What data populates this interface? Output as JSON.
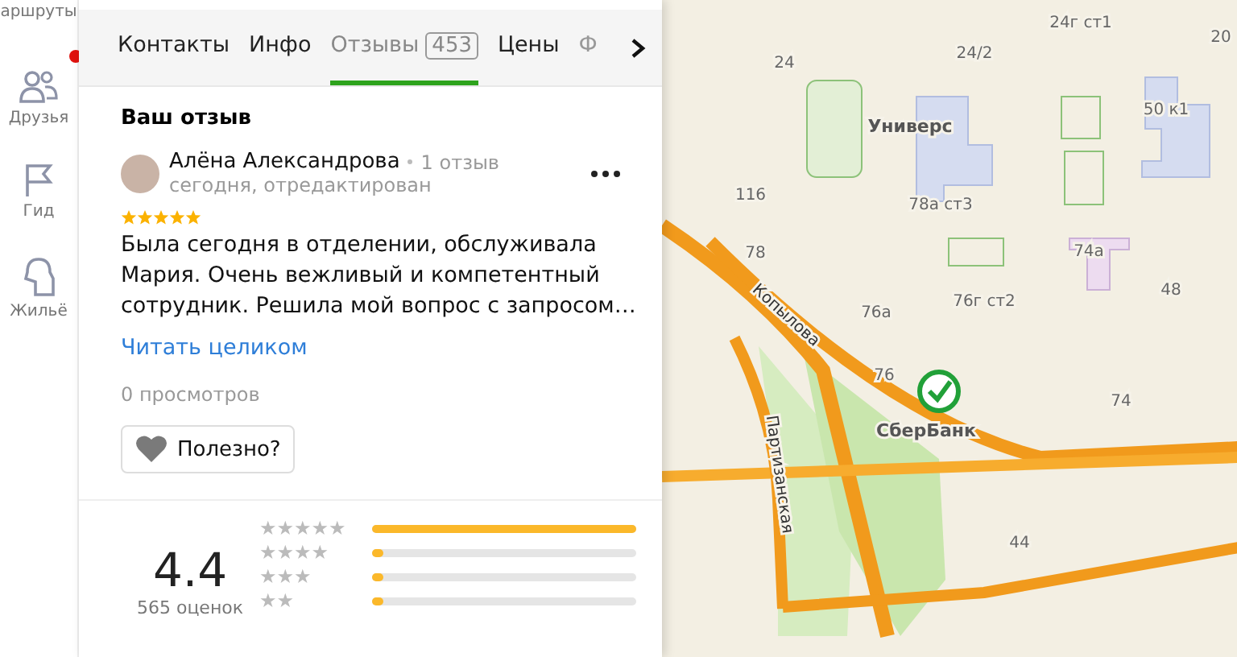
{
  "nav": [
    {
      "label": "аршруты",
      "kind": "route",
      "badge": false
    },
    {
      "label": "Друзья",
      "kind": "friends",
      "badge": true
    },
    {
      "label": "Гид",
      "kind": "guide",
      "badge": false
    },
    {
      "label": "Жильё",
      "kind": "housing",
      "badge": false
    }
  ],
  "tabs": [
    {
      "label": "Контакты",
      "selected": false,
      "faded": false
    },
    {
      "label": "Инфо",
      "selected": false,
      "faded": false
    },
    {
      "label": "Отзывы",
      "selected": true,
      "count": "453",
      "faded": false
    },
    {
      "label": "Цены",
      "selected": false,
      "faded": false
    },
    {
      "label": "Ф",
      "selected": false,
      "faded": true
    }
  ],
  "section_title": "Ваш отзыв",
  "review": {
    "author": "Алёна Александрова",
    "author_reviews": "1 отзыв",
    "date": "сегодня, отредактирован",
    "stars": 5,
    "text": "Была сегодня в отделении, обслуживала Мария. Очень вежливый и компетентный сотрудник. Решила мой вопрос с запросом…",
    "read_more": "Читать целиком",
    "views": "0 просмотров",
    "useful_button": "Полезно?"
  },
  "rating": {
    "value": "4.4",
    "count": "565 оценок",
    "rows": [
      {
        "label": "★★★★★",
        "level": 1.0
      },
      {
        "label": "★★★★",
        "level": 0.04
      },
      {
        "label": "★★★",
        "level": 0.045
      },
      {
        "label": "★★",
        "level": 0.03
      }
    ]
  },
  "map": {
    "labels": [
      "24г ст1",
      "20",
      "24",
      "24/2",
      "Универс",
      "50 к1",
      "116",
      "78а ст3",
      "78",
      "74а",
      "48",
      "76а",
      "76г ст2",
      "Копылова",
      "76",
      "74",
      "СберБанк",
      "Партизанская",
      "44"
    ]
  }
}
